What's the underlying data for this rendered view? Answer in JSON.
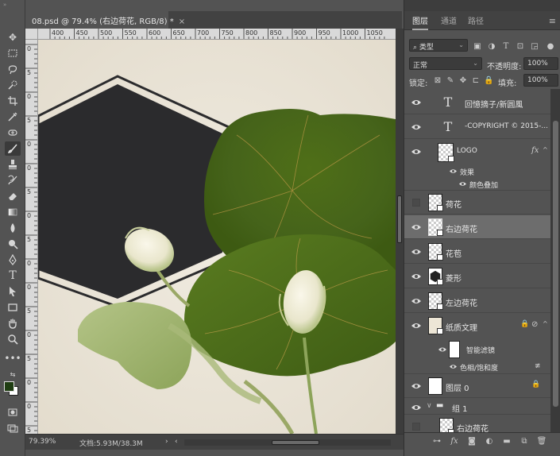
{
  "document": {
    "tab_title": "08.psd @ 79.4% (右边荷花, RGB/8) *",
    "tab_close": "×",
    "ruler_top_ticks": [
      "400",
      "450",
      "500",
      "550",
      "600",
      "650",
      "700",
      "750",
      "800",
      "850",
      "900",
      "950",
      "1000",
      "1050"
    ],
    "ruler_left_ticks": [
      "0",
      "5",
      "0",
      "5",
      "0",
      "0",
      "5",
      "0",
      "5",
      "0",
      "0",
      "5",
      "0",
      "5",
      "0",
      "0",
      "5"
    ],
    "zoom": "79.39%",
    "doc_info": "文档:5.93M/38.3M",
    "status_arrow": "›",
    "scroll_left_arrow": "‹"
  },
  "toolbar": {
    "grip": "»",
    "tools": [
      "move-tool",
      "marquee-tool",
      "lasso-tool",
      "quick-select-tool",
      "crop-tool",
      "eyedropper-tool",
      "healing-tool",
      "brush-tool",
      "stamp-tool",
      "history-brush-tool",
      "eraser-tool",
      "gradient-tool",
      "blur-tool",
      "dodge-tool",
      "pen-tool",
      "type-tool",
      "path-select-tool",
      "shape-tool",
      "hand-tool",
      "zoom-tool",
      "more-tools",
      "swap-colors",
      "foreground-color",
      "quick-mask",
      "screen-mode"
    ],
    "foreground_color": "#1f3d12",
    "background_color": "#ffffff"
  },
  "panel": {
    "tabs": [
      "图层",
      "通道",
      "路径"
    ],
    "active_tab": "图层",
    "filter_kind": "类型",
    "blend_mode": "正常",
    "opacity_label": "不透明度:",
    "opacity_value": "100%",
    "lock_label": "锁定:",
    "fill_label": "填充:",
    "fill_value": "100%",
    "menu_icon": "≡"
  },
  "layers": [
    {
      "name": "回憶摘子/新圆風",
      "type": "text",
      "visible": true
    },
    {
      "name": "-COPYRIGHT © 2015-...",
      "type": "text",
      "visible": true
    },
    {
      "name": "LOGO",
      "type": "image",
      "visible": true,
      "fx": "fx"
    },
    {
      "name": "效果",
      "type": "effect-group",
      "visible": true
    },
    {
      "name": "颜色叠加",
      "type": "effect",
      "visible": true
    },
    {
      "name": "荷花",
      "type": "smart",
      "visible": false
    },
    {
      "name": "右边荷花",
      "type": "smart",
      "visible": true,
      "selected": true
    },
    {
      "name": "花苞",
      "type": "smart",
      "visible": true
    },
    {
      "name": "菱形",
      "type": "smart",
      "visible": true
    },
    {
      "name": "左边荷花",
      "type": "smart",
      "visible": true
    },
    {
      "name": "纸质文理",
      "type": "smart",
      "visible": true,
      "locked": true
    },
    {
      "name": "智能滤镜",
      "type": "filter",
      "visible": true
    },
    {
      "name": "色相/饱和度",
      "type": "filter-item",
      "visible": true
    },
    {
      "name": "图层 0",
      "type": "white",
      "visible": true,
      "locked": true
    },
    {
      "name": "组 1",
      "type": "group",
      "visible": true
    },
    {
      "name": "右边荷花",
      "type": "smart",
      "visible": false
    }
  ],
  "bottom_icons": [
    "link-icon",
    "fx-icon",
    "mask-icon",
    "adjustment-icon",
    "folder-icon",
    "new-layer-icon",
    "trash-icon"
  ],
  "colors": {
    "lotus_leaf": "#4a6a16",
    "hexagon": "#2b2b2d",
    "paper": "#ebe5d8"
  }
}
